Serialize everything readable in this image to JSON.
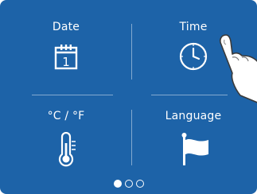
{
  "tiles": [
    {
      "label": "Date",
      "icon": "calendar-icon",
      "calendar_day": "1"
    },
    {
      "label": "Time",
      "icon": "clock-icon"
    },
    {
      "label": "°C / °F",
      "icon": "thermometer-icon"
    },
    {
      "label": "Language",
      "icon": "flag-icon"
    }
  ],
  "pager": {
    "pages": 3,
    "active": 1
  },
  "colors": {
    "background": "#1d63a8",
    "foreground": "#ffffff"
  }
}
